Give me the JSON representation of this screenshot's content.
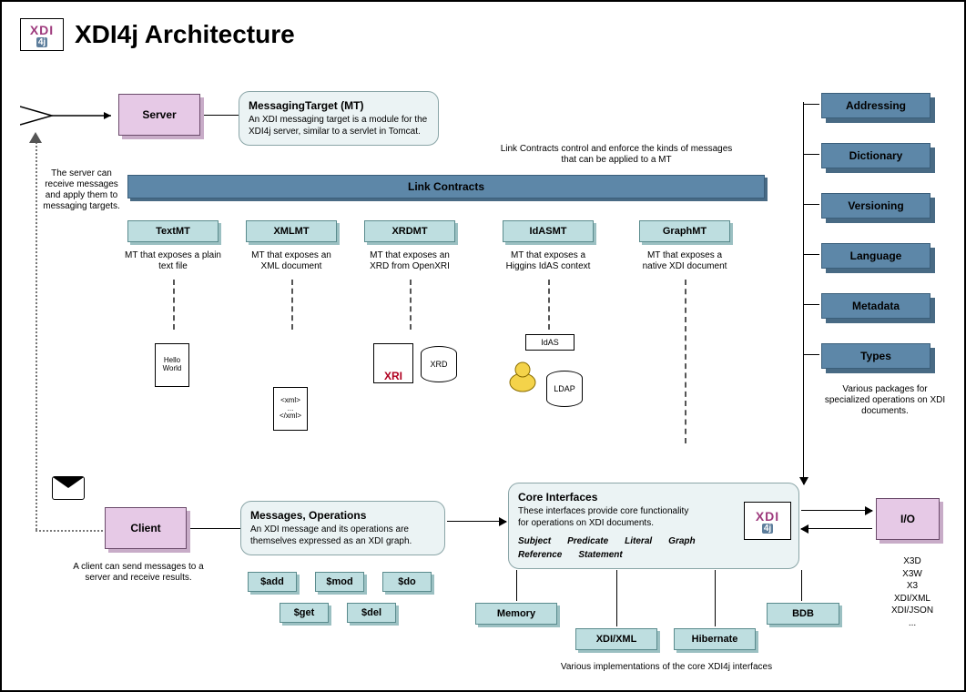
{
  "title": "XDI4j Architecture",
  "server": {
    "label": "Server",
    "note": "The server can receive messages and apply them to messaging targets."
  },
  "mt_panel": {
    "title": "MessagingTarget (MT)",
    "desc": "An XDI messaging target is a module for the XDI4j server, similar to a servlet in Tomcat."
  },
  "link_contracts": {
    "label": "Link Contracts",
    "note": "Link Contracts control and enforce the kinds of messages that can be applied to a MT"
  },
  "mts": [
    {
      "label": "TextMT",
      "desc": "MT that exposes a plain text file"
    },
    {
      "label": "XMLMT",
      "desc": "MT that exposes an XML document"
    },
    {
      "label": "XRDMT",
      "desc": "MT that exposes an XRD from OpenXRI"
    },
    {
      "label": "IdASMT",
      "desc": "MT that exposes a Higgins IdAS context"
    },
    {
      "label": "GraphMT",
      "desc": "MT that exposes a native XDI document"
    }
  ],
  "mt_artifacts": {
    "hello": "Hello World",
    "xml1": "<xml>",
    "xml2": "...",
    "xml3": "</xml>",
    "xri": "XRI",
    "xrd": "XRD",
    "idas": "IdAS",
    "ldap": "LDAP"
  },
  "side_packages": {
    "items": [
      "Addressing",
      "Dictionary",
      "Versioning",
      "Language",
      "Metadata",
      "Types"
    ],
    "note": "Various packages for specialized operations on XDI documents."
  },
  "client": {
    "label": "Client",
    "note": "A client can send messages to a server and receive results."
  },
  "messages_panel": {
    "title": "Messages, Operations",
    "desc": "An XDI message and its operations are themselves expressed as an XDI graph."
  },
  "ops": [
    "$add",
    "$mod",
    "$do",
    "$get",
    "$del"
  ],
  "core_panel": {
    "title": "Core Interfaces",
    "desc": "These interfaces provide core functionality for operations on XDI documents.",
    "terms": [
      "Subject",
      "Predicate",
      "Literal",
      "Graph",
      "Reference",
      "Statement"
    ]
  },
  "impls": {
    "items": [
      "Memory",
      "XDI/XML",
      "Hibernate",
      "BDB"
    ],
    "note": "Various implementations of the core XDI4j interfaces"
  },
  "io": {
    "label": "I/O",
    "formats": [
      "X3D",
      "X3W",
      "X3",
      "XDI/XML",
      "XDI/JSON",
      "..."
    ]
  }
}
